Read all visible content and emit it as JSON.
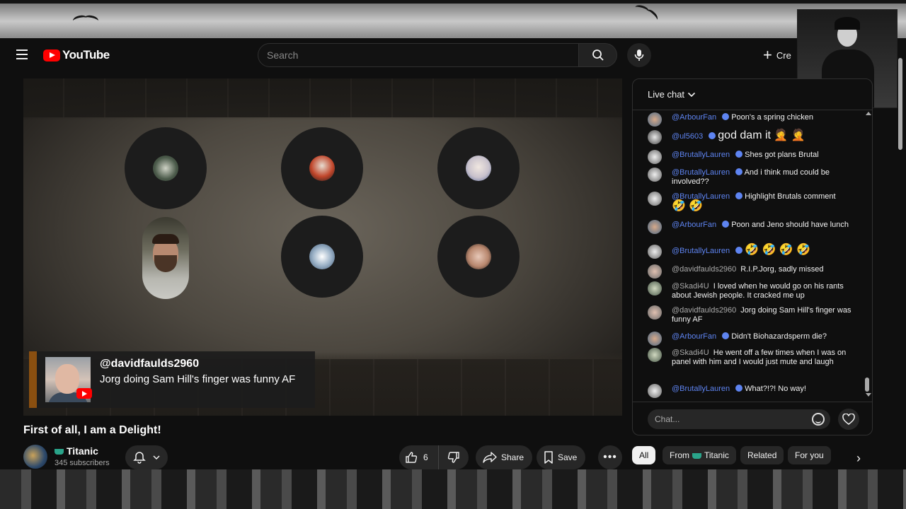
{
  "app": {
    "logo_text": "YouTube",
    "brand_red": "#ff0000"
  },
  "header": {
    "search_placeholder": "Search",
    "create_label": "Cre"
  },
  "video": {
    "banner": {
      "author": "@davidfaulds2960",
      "text": "Jorg doing Sam Hill's finger was funny AF"
    }
  },
  "meta": {
    "title": "First of all, I am a Delight!",
    "channel_name": "Titanic",
    "subscribers": "345 subscribers",
    "like_count": "6",
    "share_label": "Share",
    "save_label": "Save"
  },
  "chat": {
    "header_label": "Live chat",
    "input_placeholder": "Chat...",
    "messages": [
      {
        "author": "@ArbourFan",
        "verified": true,
        "text": "Poon's a spring chicken"
      },
      {
        "author": "@ul5603",
        "verified": true,
        "text": "god dam it 🤦 🤦"
      },
      {
        "author": "@BrutallyLauren",
        "verified": true,
        "text": "Shes got plans Brutal"
      },
      {
        "author": "@BrutallyLauren",
        "verified": true,
        "text": "And i think mud could be involved??"
      },
      {
        "author": "@BrutallyLauren",
        "verified": true,
        "text": "Highlight Brutals comment"
      },
      {
        "author": "@ArbourFan",
        "verified": true,
        "text": "Poon and Jeno should have lunch"
      },
      {
        "author": "@BrutallyLauren",
        "verified": true,
        "text": "🤣 🤣 🤣 🤣"
      },
      {
        "author": "@davidfaulds2960",
        "verified": false,
        "text": "R.I.P.Jorg, sadly missed"
      },
      {
        "author": "@Skadi4U",
        "verified": false,
        "text": "I loved when he would go on his rants about Jewish people. It cracked me up"
      },
      {
        "author": "@davidfaulds2960",
        "verified": false,
        "text": "Jorg doing Sam Hill's finger was funny AF"
      },
      {
        "author": "@ArbourFan",
        "verified": true,
        "text": "Didn't Biohazardsperm die?"
      },
      {
        "author": "@Skadi4U",
        "verified": false,
        "text": "He went off a few times when I was on panel with him and I would just mute and laugh"
      },
      {
        "author": "@BrutallyLauren",
        "verified": true,
        "text": "What?!?! No way!"
      }
    ],
    "extra_emoji": "🤣 🤣"
  },
  "chips": {
    "all": "All",
    "from_prefix": "From",
    "from_channel": "Titanic",
    "related": "Related",
    "for_you": "For you"
  },
  "icons": {
    "menu": "menu-icon",
    "search": "search-icon",
    "mic": "mic-icon",
    "create": "plus-icon",
    "bell": "bell-icon",
    "like": "thumbs-up-icon",
    "dislike": "thumbs-down-icon",
    "share": "share-arrow-icon",
    "save": "bookmark-icon",
    "more": "more-horizontal-icon",
    "emoji": "smiley-icon",
    "heart": "heart-icon",
    "next": "chevron-right-icon"
  },
  "colors": {
    "moderator_blue": "#5e84f1",
    "chip_active": "#f1f1f1",
    "surface": "#272727"
  }
}
